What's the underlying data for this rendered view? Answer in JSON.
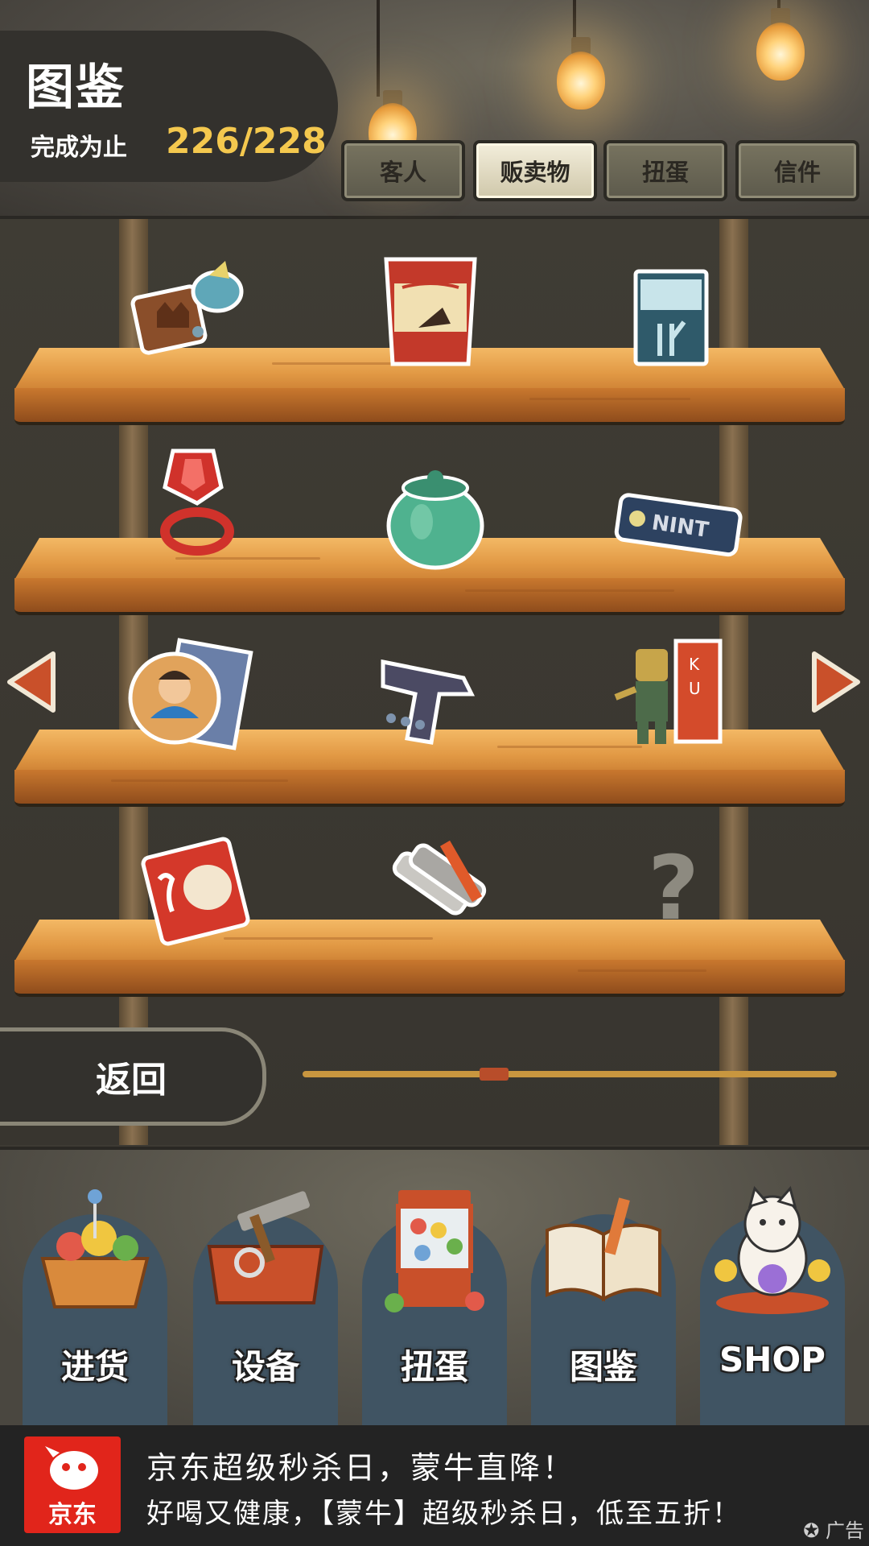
{
  "header": {
    "title": "图鉴",
    "progress_label": "完成为止",
    "progress_value": "226/228"
  },
  "tabs": [
    {
      "label": "客人",
      "active": false
    },
    {
      "label": "贩卖物",
      "active": true
    },
    {
      "label": "扭蛋",
      "active": false
    },
    {
      "label": "信件",
      "active": false
    }
  ],
  "shelf": {
    "items": [
      {
        "icon": "candy-mold-icon"
      },
      {
        "icon": "snack-bag-icon"
      },
      {
        "icon": "cigarette-box-icon"
      },
      {
        "icon": "ring-candy-icon"
      },
      {
        "icon": "green-jar-icon"
      },
      {
        "icon": "mint-gum-icon"
      },
      {
        "icon": "hero-cards-icon"
      },
      {
        "icon": "water-gun-icon"
      },
      {
        "icon": "robot-toy-icon"
      },
      {
        "icon": "menko-card-icon"
      },
      {
        "icon": "paint-tubes-icon"
      },
      {
        "icon": "unknown-item-icon",
        "label": "?"
      }
    ]
  },
  "back_label": "返回",
  "scroll_position": 0.35,
  "nav": [
    {
      "label": "进货",
      "icon": "stock-basket-icon"
    },
    {
      "label": "设备",
      "icon": "toolbox-icon"
    },
    {
      "label": "扭蛋",
      "icon": "gacha-machine-icon"
    },
    {
      "label": "图鉴",
      "icon": "open-book-icon"
    },
    {
      "label": "SHOP",
      "icon": "lucky-cat-icon"
    }
  ],
  "ad": {
    "logo_text": "京东",
    "line1": "京东超级秒杀日，蒙牛直降！",
    "line2": "好喝又健康，【蒙牛】超级秒杀日，低至五折！",
    "tag": "广告"
  },
  "colors": {
    "accent_yellow": "#f4c84e",
    "wood": "#e29a45",
    "arrow_red": "#c9502a",
    "ad_red": "#e1251b"
  }
}
